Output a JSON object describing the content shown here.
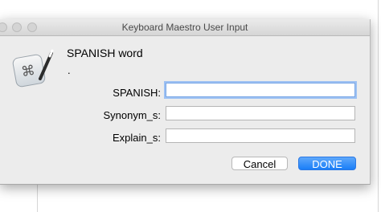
{
  "window": {
    "title": "Keyboard Maestro User Input"
  },
  "dialog": {
    "prompt": "SPANISH word",
    "subtext": "."
  },
  "fields": [
    {
      "label": "SPANISH:",
      "value": ""
    },
    {
      "label": "Synonym_s:",
      "value": ""
    },
    {
      "label": "Explain_s:",
      "value": ""
    }
  ],
  "buttons": {
    "cancel": "Cancel",
    "done": "DONE"
  },
  "colors": {
    "accent": "#1a7ef7",
    "focus_ring": "#9dc1f3"
  },
  "icons": {
    "app": "keyboard-maestro-icon"
  }
}
